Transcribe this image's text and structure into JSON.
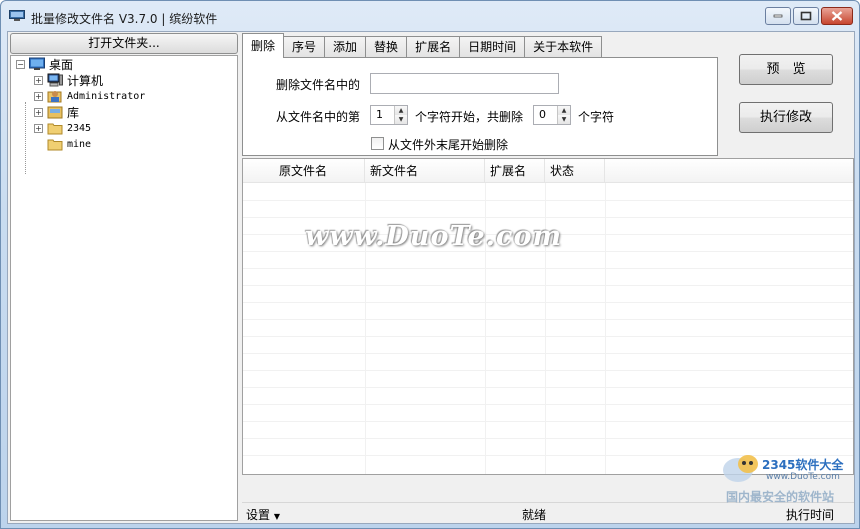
{
  "window": {
    "title": "批量修改文件名 V3.7.0 | 缤纷软件"
  },
  "left_pane": {
    "open_folder_button": "打开文件夹...",
    "tree": [
      {
        "label": "桌面",
        "icon": "desktop-icon"
      },
      {
        "label": "计算机",
        "icon": "computer-icon"
      },
      {
        "label": "Administrator",
        "icon": "user-folder-icon"
      },
      {
        "label": "库",
        "icon": "library-icon"
      },
      {
        "label": "2345",
        "icon": "folder-icon"
      },
      {
        "label": "mine",
        "icon": "folder-icon"
      }
    ]
  },
  "tabs": [
    "删除",
    "序号",
    "添加",
    "替换",
    "扩展名",
    "日期时间",
    "关于本软件"
  ],
  "delete_tab": {
    "delete_text_label": "删除文件名中的",
    "delete_text_value": "",
    "from_position_label": "从文件名中的第",
    "start_value": "1",
    "start_suffix": "个字符开始，共删除",
    "count_value": "0",
    "count_suffix": "个字符",
    "from_end_checkbox": "从文件外末尾开始删除"
  },
  "buttons": {
    "preview": "预　览",
    "execute": "执行修改"
  },
  "list": {
    "columns": [
      "原文件名",
      "新文件名",
      "扩展名",
      "状态"
    ]
  },
  "status": {
    "settings": "设置",
    "state": "就绪",
    "exec_time": "执行时间"
  },
  "watermark": "www.DuoTe.com",
  "corner_logo": {
    "brand": "2345软件大全",
    "url": "www.DuoTe.com",
    "slogan": "国内最安全的软件站"
  }
}
